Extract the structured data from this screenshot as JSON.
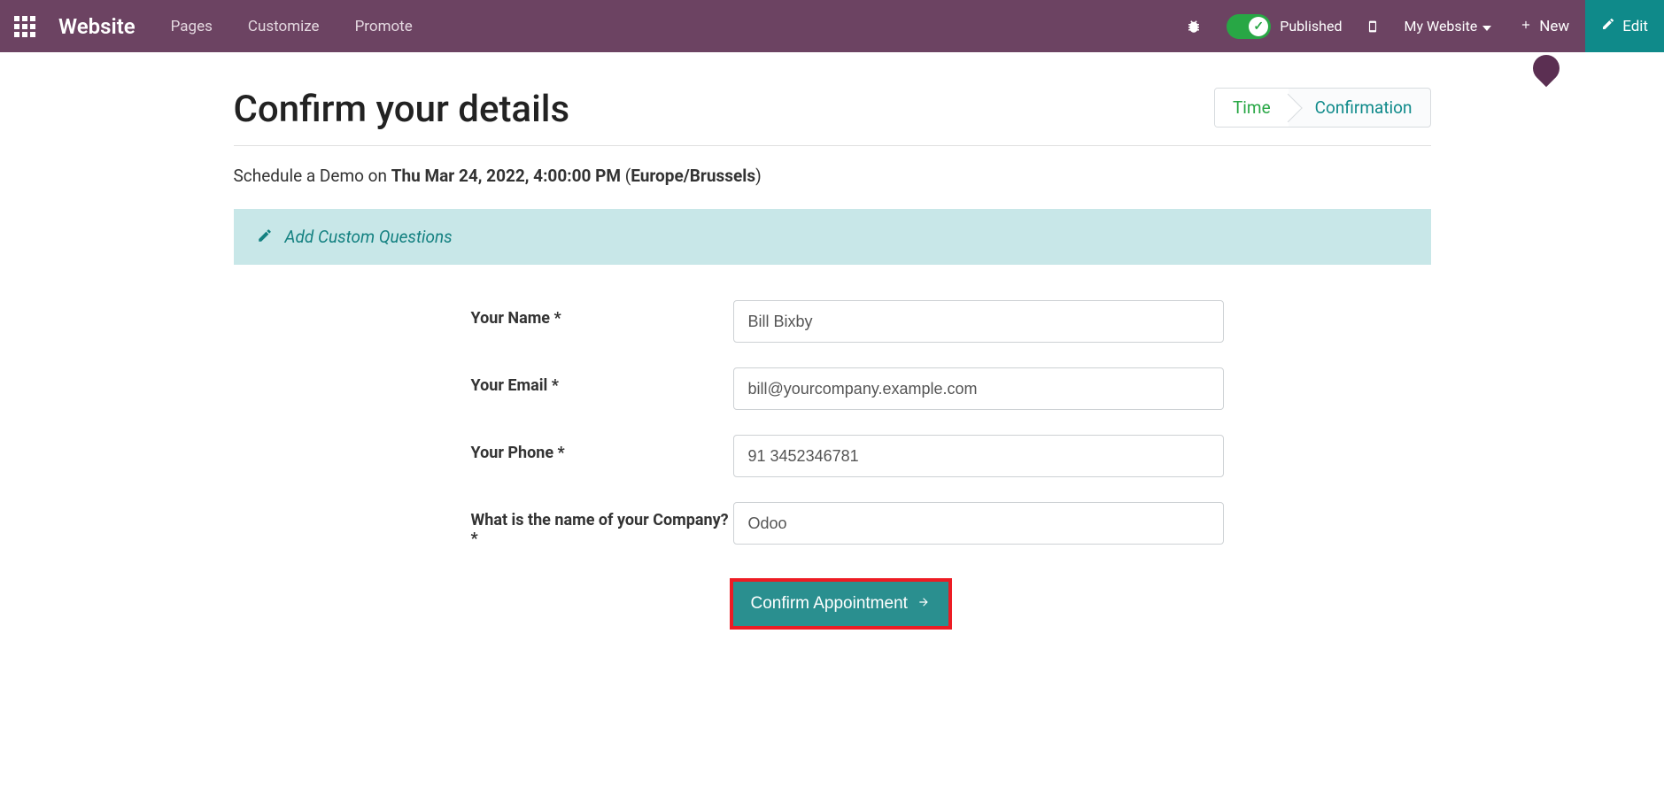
{
  "navbar": {
    "brand": "Website",
    "menu": {
      "pages": "Pages",
      "customize": "Customize",
      "promote": "Promote"
    },
    "published_label": "Published",
    "my_website": "My Website",
    "new_label": "New",
    "edit_label": "Edit"
  },
  "page": {
    "title": "Confirm your details",
    "steps": {
      "time": "Time",
      "confirmation": "Confirmation"
    },
    "schedule": {
      "prefix": "Schedule a Demo on ",
      "datetime": "Thu Mar 24, 2022, 4:00:00 PM",
      "tz_open": " (",
      "tz": "Europe/Brussels",
      "tz_close": ")"
    },
    "custom_questions": "Add Custom Questions"
  },
  "form": {
    "name": {
      "label": "Your Name *",
      "value": "Bill Bixby"
    },
    "email": {
      "label": "Your Email *",
      "value": "bill@yourcompany.example.com"
    },
    "phone": {
      "label": "Your Phone *",
      "value": "91 3452346781"
    },
    "company": {
      "label": "What is the name of your Company? *",
      "value": "Odoo"
    },
    "submit": "Confirm Appointment"
  },
  "colors": {
    "navbar_bg": "#6c4362",
    "accent": "#0f8a8a",
    "success": "#28a745",
    "highlight_border": "#ed1c24",
    "banner_bg": "#c8e7e8"
  }
}
